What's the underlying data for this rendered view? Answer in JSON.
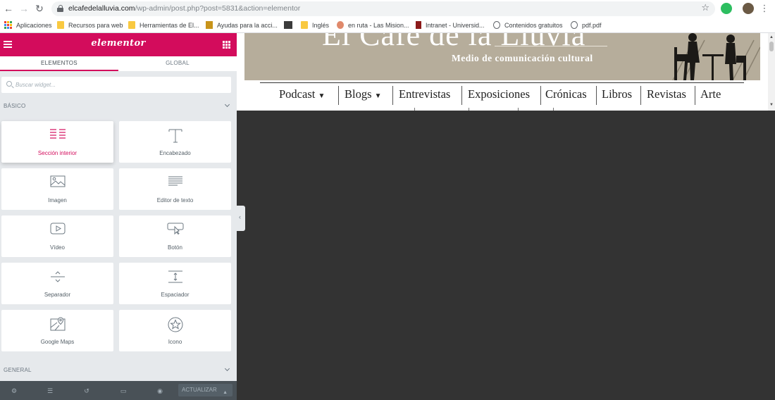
{
  "browser": {
    "url_host": "elcafedelalluvia.com",
    "url_path": "/wp-admin/post.php?post=5831&action=elementor",
    "bookmarks": [
      {
        "label": "Aplicaciones",
        "icon": "apps-icon"
      },
      {
        "label": "Recursos para web",
        "icon": "folder-icon"
      },
      {
        "label": "Herramientas de El...",
        "icon": "folder-icon"
      },
      {
        "label": "Ayudas para la acci...",
        "icon": "site-favicon-icon"
      },
      {
        "label": "",
        "icon": "site-favicon-icon"
      },
      {
        "label": "Inglés",
        "icon": "folder-icon"
      },
      {
        "label": "en ruta - Las Mision...",
        "icon": "site-favicon-icon"
      },
      {
        "label": "Intranet - Universid...",
        "icon": "site-favicon-icon"
      },
      {
        "label": "Contenidos gratuitos",
        "icon": "globe-icon"
      },
      {
        "label": "pdf.pdf",
        "icon": "globe-icon"
      }
    ]
  },
  "panel": {
    "logo": "elementor",
    "tabs": [
      {
        "label": "ELEMENTOS",
        "active": true
      },
      {
        "label": "GLOBAL",
        "active": false
      }
    ],
    "search_placeholder": "Buscar widget...",
    "sections": {
      "basic": "BÁSICO",
      "general": "GENERAL"
    },
    "widgets": [
      {
        "label": "Sección interior",
        "icon": "inner-section-icon",
        "selected": true
      },
      {
        "label": "Encabezado",
        "icon": "heading-icon",
        "selected": false
      },
      {
        "label": "Imagen",
        "icon": "image-icon",
        "selected": false
      },
      {
        "label": "Editor de texto",
        "icon": "text-editor-icon",
        "selected": false
      },
      {
        "label": "Vídeo",
        "icon": "video-icon",
        "selected": false
      },
      {
        "label": "Botón",
        "icon": "button-icon",
        "selected": false
      },
      {
        "label": "Separador",
        "icon": "divider-icon",
        "selected": false
      },
      {
        "label": "Espaciador",
        "icon": "spacer-icon",
        "selected": false
      },
      {
        "label": "Google Maps",
        "icon": "map-icon",
        "selected": false
      },
      {
        "label": "Icono",
        "icon": "star-icon",
        "selected": false
      }
    ],
    "footer": {
      "publish_label": "ACTUALIZAR"
    }
  },
  "site": {
    "title": "El Café de la Lluvia",
    "subtitle": "Medio de comunicación cultural",
    "nav": [
      {
        "label": "Podcast",
        "dropdown": true
      },
      {
        "label": "Blogs",
        "dropdown": true
      },
      {
        "label": "Entrevistas",
        "dropdown": false
      },
      {
        "label": "Exposiciones",
        "dropdown": false
      },
      {
        "label": "Crónicas",
        "dropdown": false
      },
      {
        "label": "Libros",
        "dropdown": false
      },
      {
        "label": "Revistas",
        "dropdown": false
      },
      {
        "label": "Arte",
        "dropdown": false
      }
    ]
  },
  "colors": {
    "brand": "#d30c5c",
    "panel_bg": "#e6e9ec",
    "preview_bg": "#333333",
    "banner_bg": "#b6ad9b"
  }
}
